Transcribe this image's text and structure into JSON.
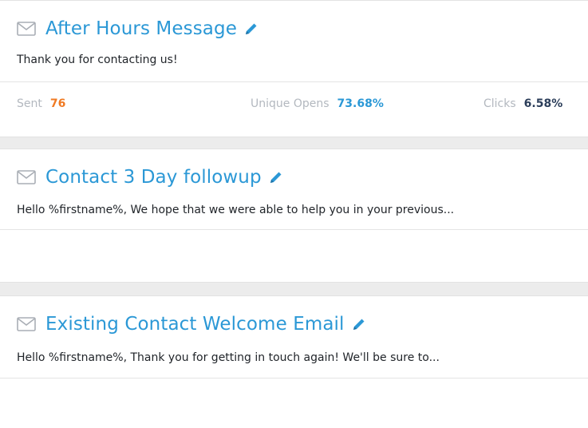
{
  "icons": {
    "mail": "mail-icon",
    "edit": "pencil-icon"
  },
  "colors": {
    "title": "#2b98d6",
    "sent": "#f07a23",
    "opens": "#2b98d6",
    "clicks": "#2c3e5a"
  },
  "messages": [
    {
      "title": "After Hours Message",
      "preview": "Thank you for contacting us!",
      "stats": {
        "sent_label": "Sent",
        "sent_value": "76",
        "opens_label": "Unique Opens",
        "opens_value": "73.68%",
        "clicks_label": "Clicks",
        "clicks_value": "6.58%"
      }
    },
    {
      "title": "Contact 3 Day followup",
      "preview": "Hello %firstname%, We hope that we were able to help you in your previous..."
    },
    {
      "title": "Existing Contact Welcome Email",
      "preview": "Hello %firstname%, Thank you for getting in touch again! We'll be sure to..."
    }
  ]
}
